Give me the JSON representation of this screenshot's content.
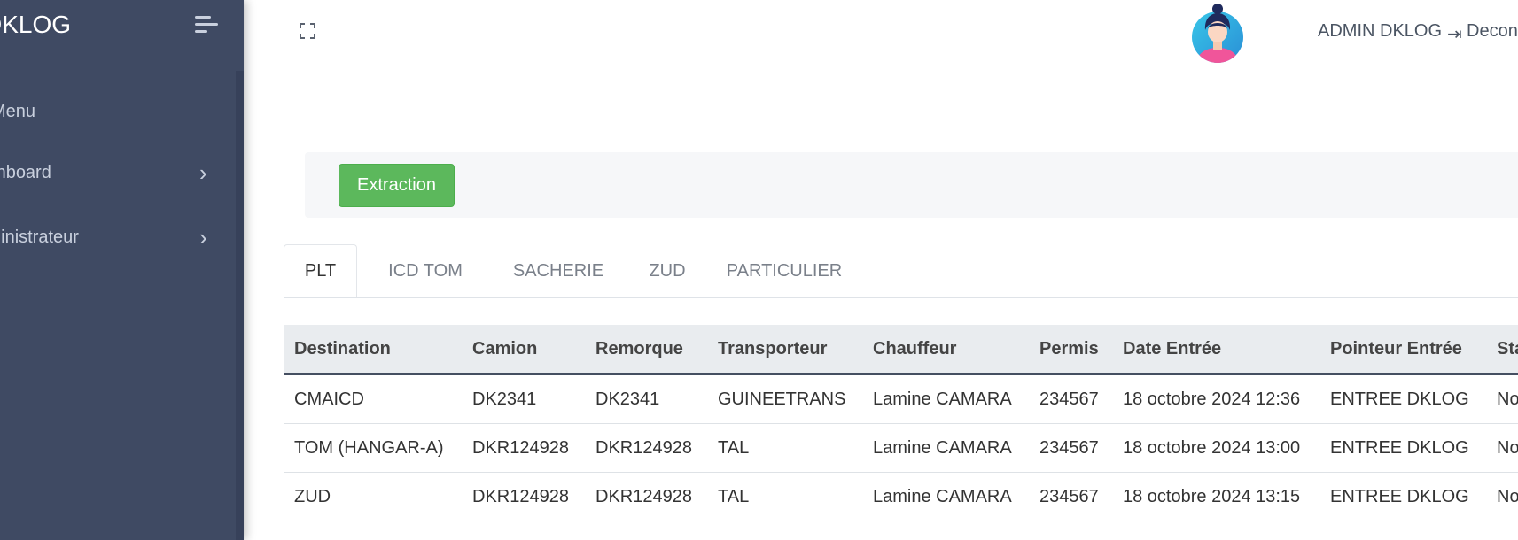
{
  "sidebar": {
    "brand": "DKLOG",
    "section_title": "Menu",
    "items": [
      {
        "label": "Dashboard"
      },
      {
        "label": "Administrateur"
      }
    ]
  },
  "header": {
    "user_name": "ADMIN DKLOG",
    "logout_label": "Deconnexion"
  },
  "toolbar": {
    "extraction_label": "Extraction",
    "extraction_color": "#5cb85c"
  },
  "tabs": [
    {
      "label": "PLT",
      "active": true
    },
    {
      "label": "ICD TOM",
      "active": false
    },
    {
      "label": "SACHERIE",
      "active": false
    },
    {
      "label": "ZUD",
      "active": false
    },
    {
      "label": "PARTICULIER",
      "active": false
    }
  ],
  "table": {
    "columns": [
      "Destination",
      "Camion",
      "Remorque",
      "Transporteur",
      "Chauffeur",
      "Permis",
      "Date Entrée",
      "Pointeur Entrée",
      "Statut"
    ],
    "rows": [
      [
        "CMAICD",
        "DK2341",
        "DK2341",
        "GUINEETRANS",
        "Lamine CAMARA",
        "234567",
        "18 octobre 2024 12:36",
        "ENTREE DKLOG",
        "Non"
      ],
      [
        "TOM (HANGAR-A)",
        "DKR124928",
        "DKR124928",
        "TAL",
        "Lamine CAMARA",
        "234567",
        "18 octobre 2024 13:00",
        "ENTREE DKLOG",
        "Non"
      ],
      [
        "ZUD",
        "DKR124928",
        "DKR124928",
        "TAL",
        "Lamine CAMARA",
        "234567",
        "18 octobre 2024 13:15",
        "ENTREE DKLOG",
        "Non"
      ]
    ]
  },
  "icons": {
    "menu_toggle": "menu-toggle-icon",
    "fullscreen": "fullscreen-icon",
    "chevron": "chevron-right-icon",
    "logout": "logout-icon"
  }
}
